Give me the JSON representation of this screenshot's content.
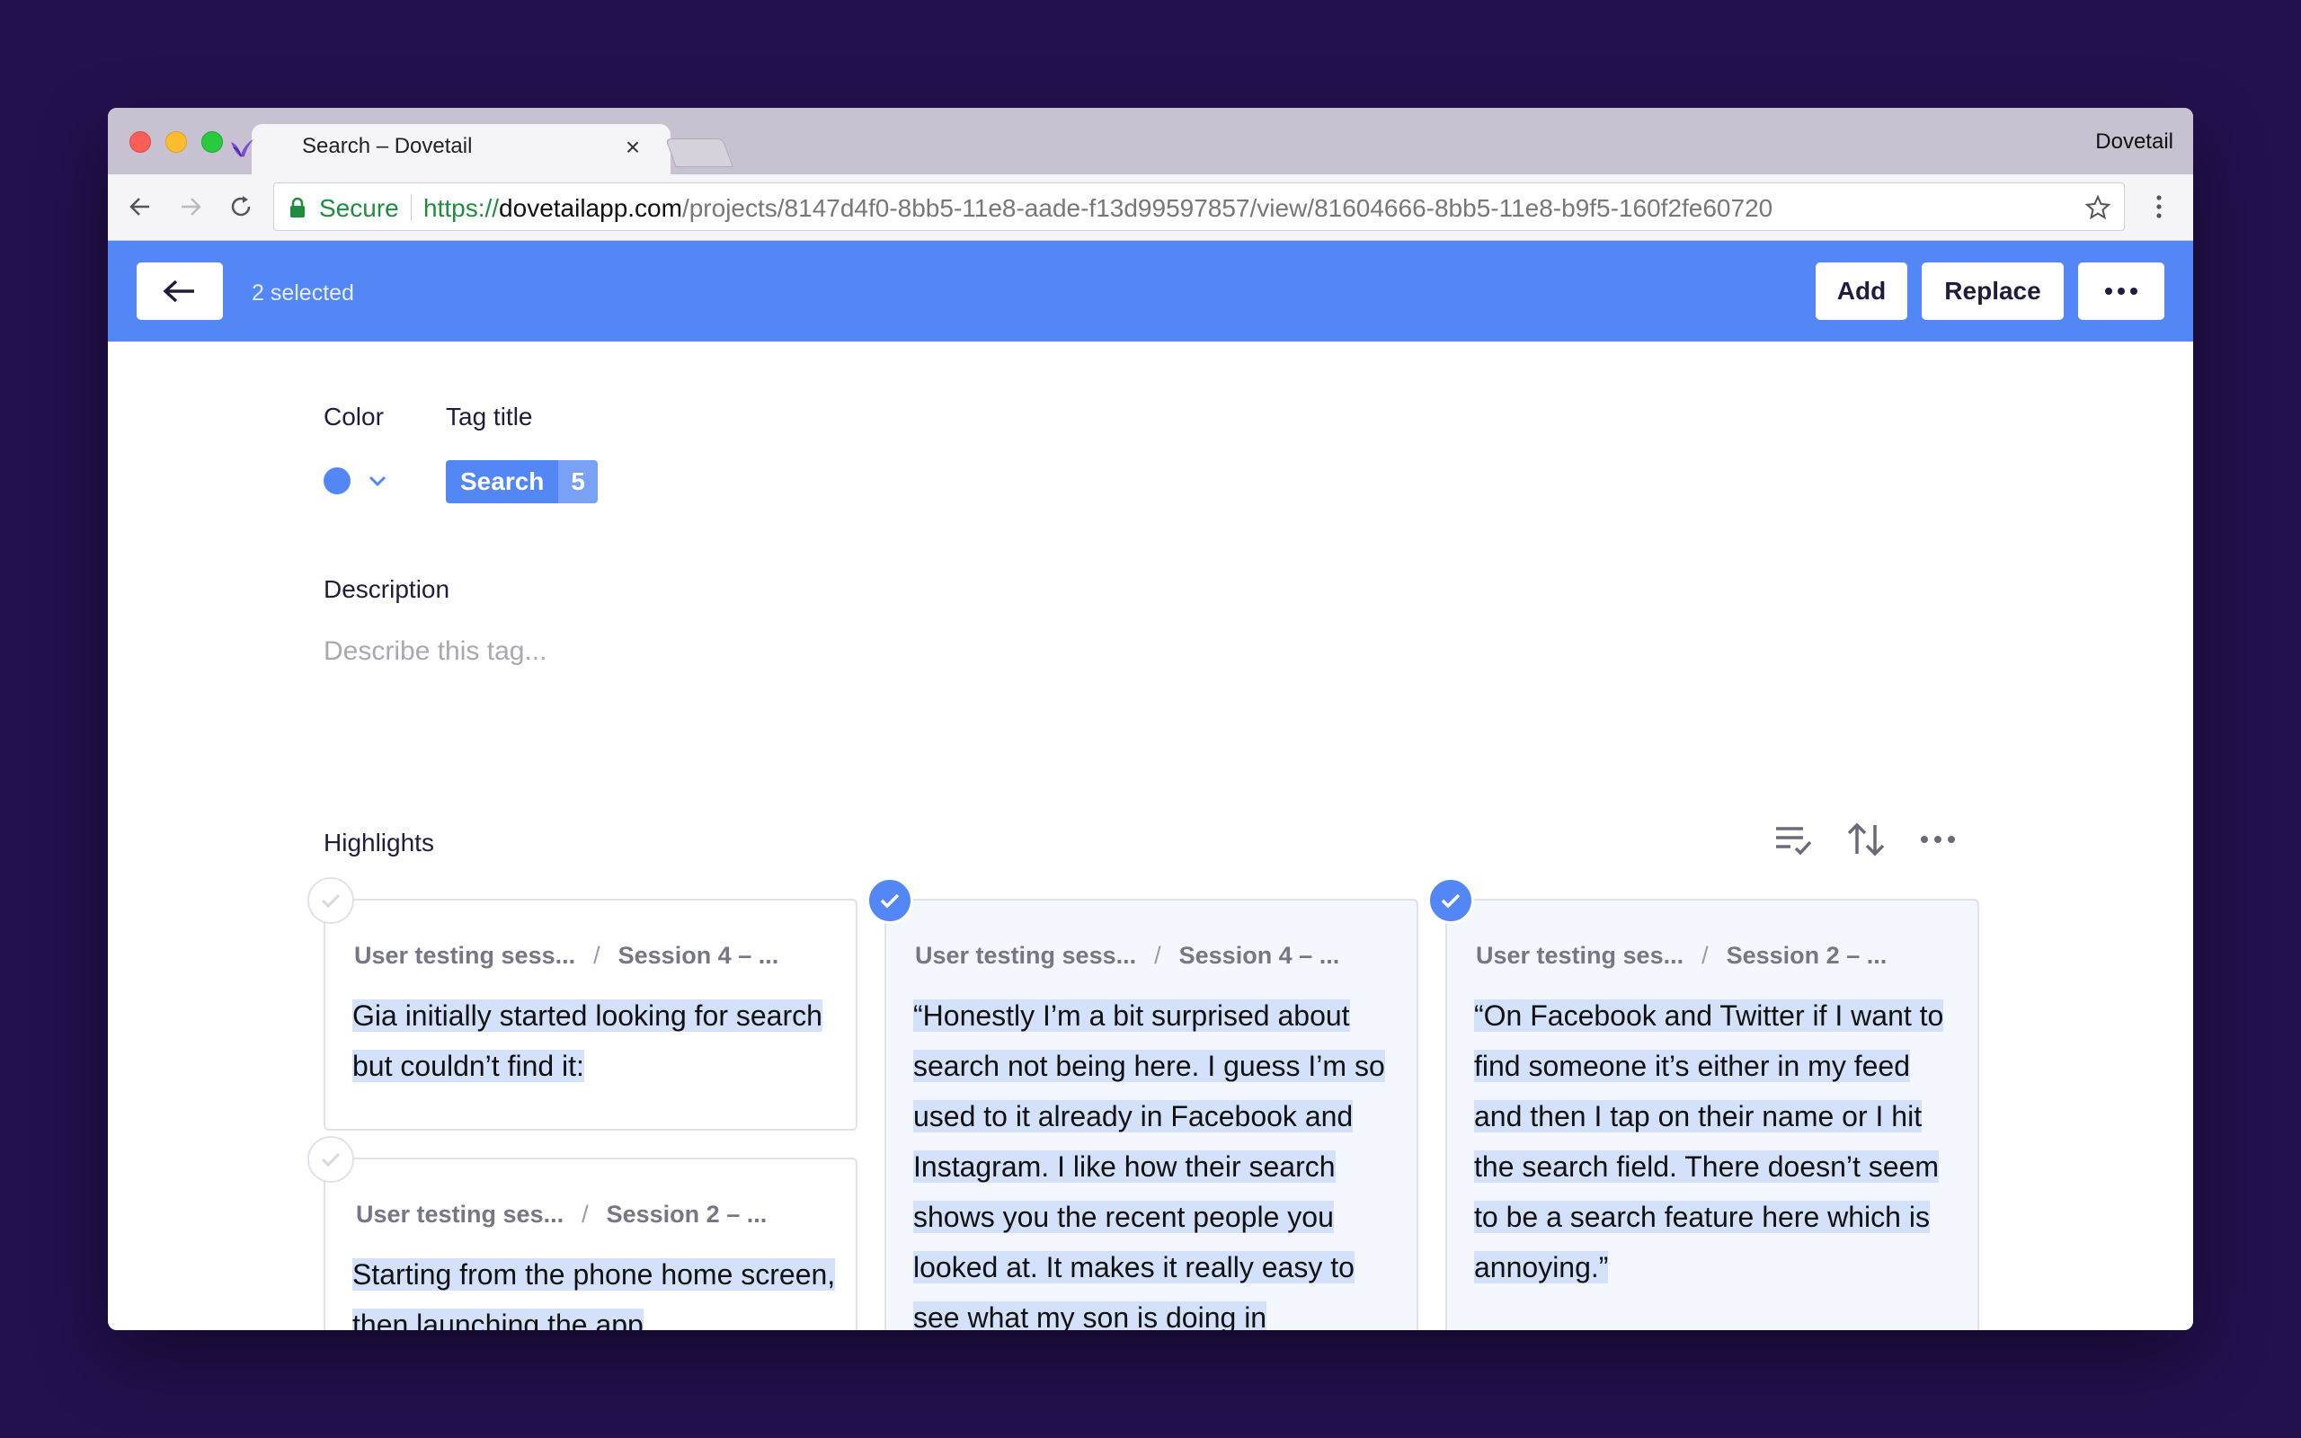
{
  "browser": {
    "tab_title": "Search – Dovetail",
    "profile_name": "Dovetail",
    "secure_label": "Secure",
    "url_scheme": "https://",
    "url_host": "dovetailapp.com",
    "url_path": "/projects/8147d4f0-8bb5-11e8-aade-f13d99597857/view/81604666-8bb5-11e8-b9f5-160f2fe60720"
  },
  "header": {
    "selected_text": "2 selected",
    "add_label": "Add",
    "replace_label": "Replace"
  },
  "tag": {
    "color_label": "Color",
    "title_label": "Tag title",
    "name": "Search",
    "count": "5",
    "color": "#5387f5"
  },
  "description": {
    "label": "Description",
    "placeholder": "Describe this tag..."
  },
  "highlights": {
    "label": "Highlights",
    "cards": [
      {
        "project": "User testing sess...",
        "session": "Session 4 – ...",
        "text": "Gia initially started looking for search but couldn’t find it:",
        "selected": false
      },
      {
        "project": "User testing ses...",
        "session": "Session 2 – ...",
        "text": "Starting from the phone home screen, then launching the app",
        "selected": false
      },
      {
        "project": "User testing sess...",
        "session": "Session 4 – ...",
        "text": "“Honestly I’m a bit surprised about search not being here. I guess I’m so used to it already in Facebook and Instagram. I like how their search shows you the recent people you looked at. It makes it really easy to see what my son is doing in",
        "selected": true
      },
      {
        "project": "User testing ses...",
        "session": "Session 2 – ...",
        "text": "“On Facebook and Twitter if I want to find someone it’s either in my feed and then I tap on their name or I hit the search field. There doesn’t seem to be a search feature here which is annoying.”",
        "selected": true
      }
    ]
  },
  "colors": {
    "accent": "#5387f5",
    "background": "#23104f",
    "highlight": "#d4e1fb"
  }
}
